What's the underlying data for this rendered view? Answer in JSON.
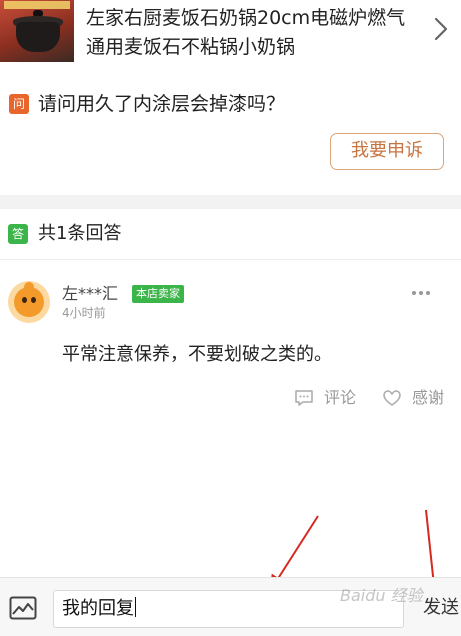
{
  "product": {
    "title_line1": "左家右厨麦饭石奶锅20cm电磁炉燃气",
    "title_line2": "通用麦饭石不粘锅小奶锅"
  },
  "question": {
    "badge": "问",
    "text": "请问用久了内涂层会掉漆吗？",
    "complain_label": "我要申诉"
  },
  "answers": {
    "badge": "答",
    "count_text": "共1条回答",
    "items": [
      {
        "user": "左***汇",
        "seller_badge": "本店卖家",
        "time": "4小时前",
        "text": "平常注意保养，不要划破之类的。",
        "comment_label": "评论",
        "thanks_label": "感谢"
      }
    ]
  },
  "reply_bar": {
    "input_value": "我的回复",
    "send_label": "发送"
  },
  "watermark": "Baidu 经验",
  "colors": {
    "question_badge": "#e8662b",
    "answer_badge": "#3bb54a",
    "complain_border": "#d9a57a",
    "complain_text": "#c7753f",
    "annotation_arrow": "#d42a20"
  },
  "icons": [
    "chevron-right-icon",
    "more-dots-icon",
    "comment-icon",
    "thanks-icon",
    "image-icon",
    "annotation-arrow"
  ]
}
